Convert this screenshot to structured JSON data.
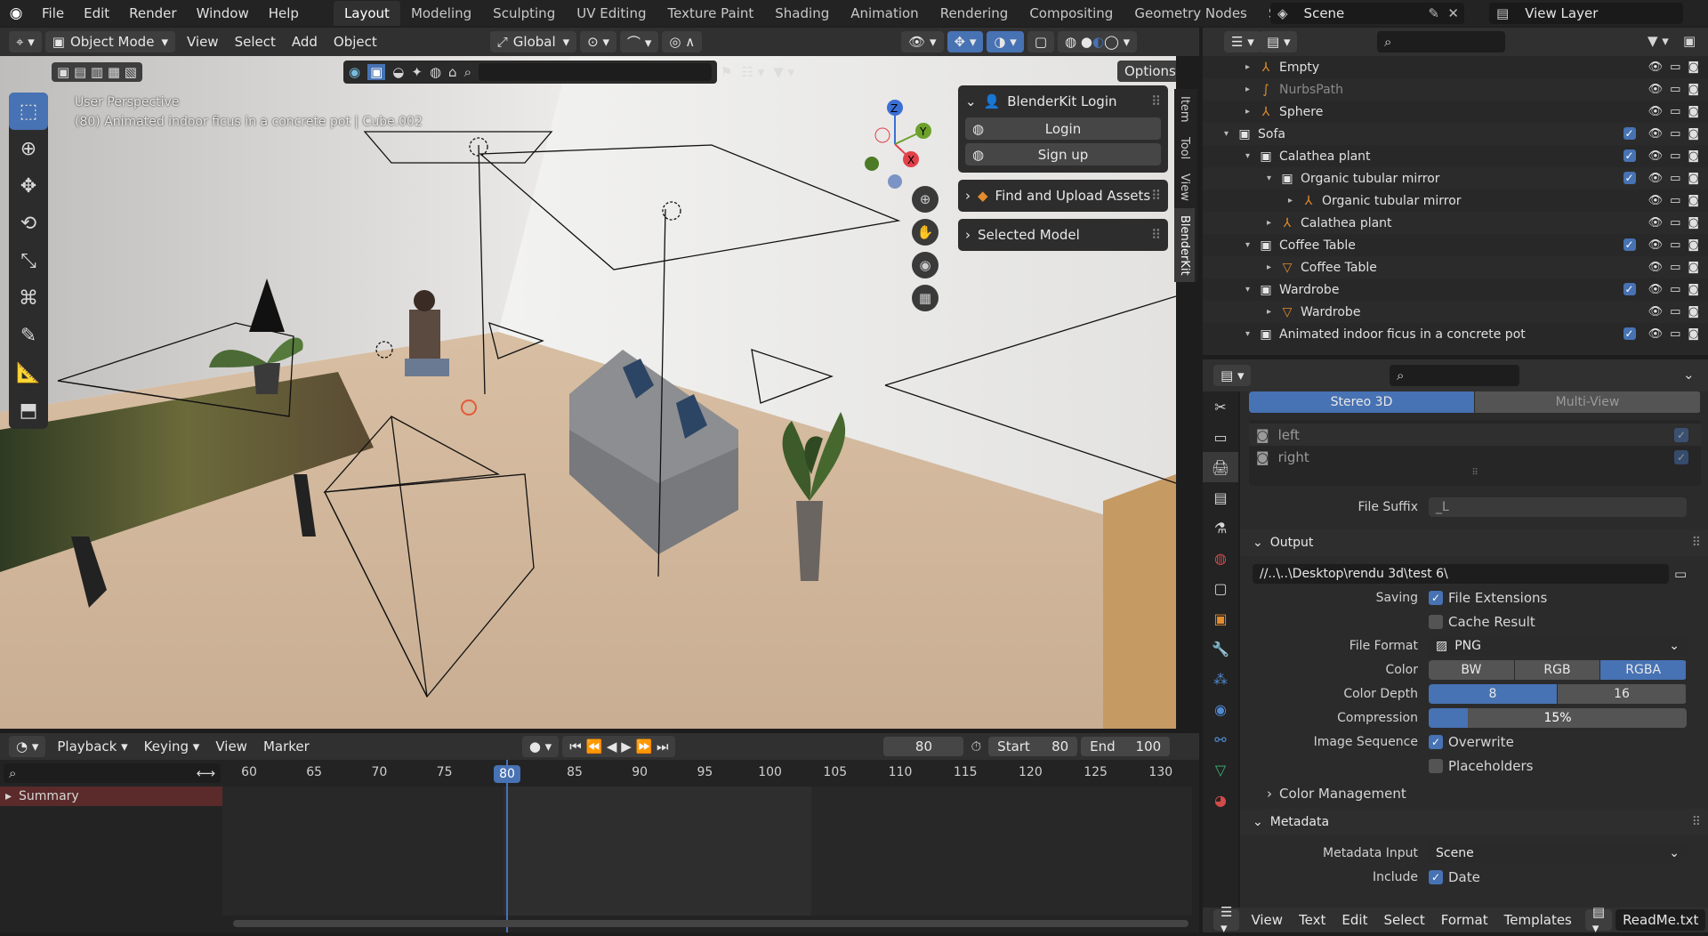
{
  "menu": {
    "items": [
      "File",
      "Edit",
      "Render",
      "Window",
      "Help"
    ]
  },
  "workspaces": [
    "Layout",
    "Modeling",
    "Sculpting",
    "UV Editing",
    "Texture Paint",
    "Shading",
    "Animation",
    "Rendering",
    "Compositing",
    "Geometry Nodes",
    "Scripting"
  ],
  "active_workspace": "Layout",
  "add_workspace": "+",
  "scene": "Scene",
  "view_layer": "View Layer",
  "viewport_header": {
    "mode": "Object Mode",
    "view": "View",
    "select": "Select",
    "add": "Add",
    "object": "Object",
    "orientation": "Global",
    "options": "Options"
  },
  "viewport": {
    "perspective": "User Perspective",
    "object_info": "(80) Animated indoor ficus in a concrete pot | Cube.002"
  },
  "gizmo": {
    "z": "Z",
    "y": "Y",
    "x": "X"
  },
  "npanel": {
    "login_title": "BlenderKit Login",
    "login_btn": "Login",
    "signup_btn": "Sign up",
    "find_assets": "Find and Upload Assets",
    "selected_model": "Selected Model"
  },
  "side_tabs": [
    "Item",
    "Tool",
    "View",
    "BlenderKit"
  ],
  "timeline": {
    "playback": "Playback",
    "keying": "Keying",
    "view": "View",
    "marker": "Marker",
    "current_frame": "80",
    "start_label": "Start",
    "start": "80",
    "end_label": "End",
    "end": "100",
    "summary": "Summary",
    "frames": [
      "60",
      "65",
      "70",
      "75",
      "80",
      "85",
      "90",
      "95",
      "100",
      "105",
      "110",
      "115",
      "120",
      "125",
      "130"
    ]
  },
  "outliner": {
    "rows": [
      {
        "name": "Empty",
        "level": 1,
        "type": "empty",
        "expand": "▸"
      },
      {
        "name": "NurbsPath",
        "level": 1,
        "type": "curve",
        "expand": "▸",
        "dim": true
      },
      {
        "name": "Sphere",
        "level": 1,
        "type": "empty",
        "expand": "▸"
      },
      {
        "name": "Sofa",
        "level": 0,
        "type": "collection",
        "expand": "▾"
      },
      {
        "name": "Calathea plant",
        "level": 1,
        "type": "collection",
        "expand": "▾"
      },
      {
        "name": "Organic tubular mirror",
        "level": 2,
        "type": "collection",
        "expand": "▾"
      },
      {
        "name": "Organic tubular mirror",
        "level": 3,
        "type": "empty",
        "expand": "▸"
      },
      {
        "name": "Calathea plant",
        "level": 2,
        "type": "empty",
        "expand": "▸"
      },
      {
        "name": "Coffee Table",
        "level": 1,
        "type": "collection",
        "expand": "▾"
      },
      {
        "name": "Coffee Table",
        "level": 2,
        "type": "mesh",
        "expand": "▸"
      },
      {
        "name": "Wardrobe",
        "level": 1,
        "type": "collection",
        "expand": "▾"
      },
      {
        "name": "Wardrobe",
        "level": 2,
        "type": "mesh",
        "expand": "▸"
      },
      {
        "name": "Animated indoor ficus in a concrete pot",
        "level": 1,
        "type": "collection",
        "expand": "▾"
      }
    ]
  },
  "properties": {
    "stereo_tab": "Stereo 3D",
    "multiview_tab": "Multi-View",
    "views": [
      "left",
      "right"
    ],
    "file_suffix_label": "File Suffix",
    "file_suffix": "_L",
    "output_section": "Output",
    "output_path": "//..\\..\\Desktop\\rendu 3d\\test 6\\",
    "saving_label": "Saving",
    "file_extensions": "File Extensions",
    "cache_result": "Cache Result",
    "file_format_label": "File Format",
    "file_format": "PNG",
    "color_label": "Color",
    "color_opts": [
      "BW",
      "RGB",
      "RGBA"
    ],
    "color_selected": "RGBA",
    "depth_label": "Color Depth",
    "depth_opts": [
      "8",
      "16"
    ],
    "depth_selected": "8",
    "compression_label": "Compression",
    "compression": "15%",
    "compression_value": 0.15,
    "image_seq_label": "Image Sequence",
    "overwrite": "Overwrite",
    "placeholders": "Placeholders",
    "color_management": "Color Management",
    "metadata_section": "Metadata",
    "metadata_input_label": "Metadata Input",
    "metadata_input": "Scene",
    "include_label": "Include",
    "date": "Date"
  },
  "text_editor": {
    "view": "View",
    "text": "Text",
    "edit": "Edit",
    "select": "Select",
    "format": "Format",
    "templates": "Templates",
    "file": "ReadMe.txt"
  },
  "colors": {
    "accent": "#4772b3",
    "bg": "#1d1d1d",
    "panel": "#303030"
  }
}
